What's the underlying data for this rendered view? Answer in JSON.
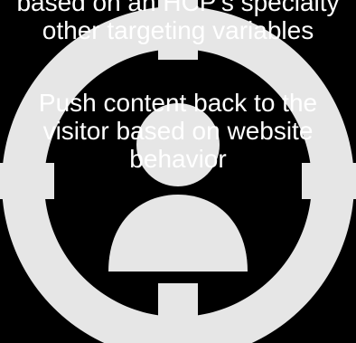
{
  "slide": {
    "background_color": "#000000",
    "graphic_color": "#e6e6e6",
    "text_color": "#ffffff",
    "icon": "target-person-icon",
    "paragraphs": [
      {
        "lines": [
          "based on an HCP's specialty",
          "other targeting variables"
        ]
      },
      {
        "lines": [
          "Push content back to the",
          "visitor based on website",
          "behavior"
        ]
      }
    ]
  }
}
